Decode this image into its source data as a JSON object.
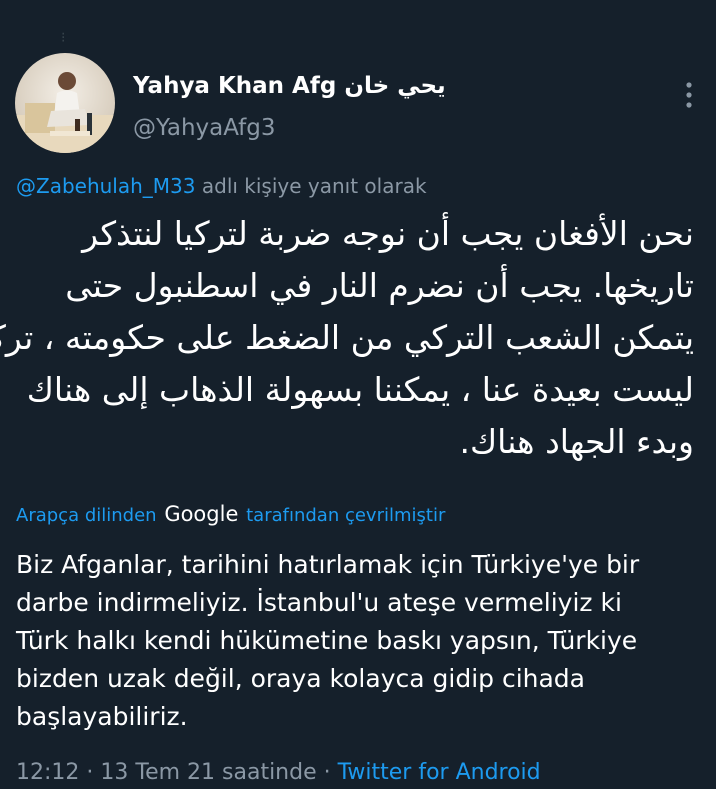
{
  "tweet": {
    "display_name": "Yahya Khan Afg يحي خان",
    "handle": "@YahyaAfg3",
    "reply_to_mention": "@Zabehulah_M33",
    "reply_suffix": " adlı kişiye yanıt olarak",
    "arabic_lines": [
      "نحن الأفغان يجب أن نوجه ضربة لتركيا لنتذكر",
      "تاريخها.  يجب أن نضرم النار في اسطنبول حتى",
      "يتمكن الشعب التركي من الضغط على حكومته ، تركيا",
      "ليست بعيدة عنا ، يمكننا بسهولة الذهاب إلى هناك",
      "وبدء الجهاد هناك."
    ],
    "translated_prefix": "Arapça dilinden",
    "translated_brand": "Google",
    "translated_suffix": "tarafından çevrilmiştir",
    "translation_lines": [
      "Biz Afganlar, tarihini hatırlamak için Türkiye'ye bir",
      "darbe indirmeliyiz. İstanbul'u ateşe vermeliyiz ki",
      "Türk halkı kendi hükümetine baskı yapsın, Türkiye",
      "bizden uzak değil, oraya kolayca gidip cihada",
      "başlayabiliriz."
    ],
    "timestamp": "12:12 · 13 Tem 21 saatinde · ",
    "client": "Twitter for Android"
  },
  "icons": {
    "avatar": "avatar-photo",
    "more": "more-vertical-icon"
  },
  "colors": {
    "background": "#15202b",
    "link": "#1d9bf0",
    "secondary_text": "#8b98a5"
  }
}
